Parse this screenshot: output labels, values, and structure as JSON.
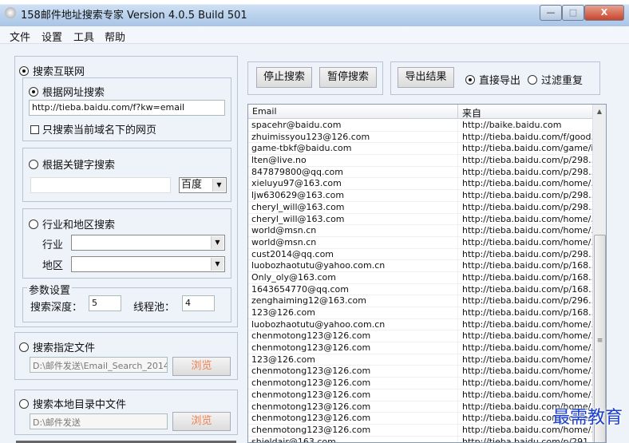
{
  "window": {
    "title": "158邮件地址搜索专家 Version 4.0.5 Build 501",
    "minimize": "—",
    "maximize": "□",
    "close": "X"
  },
  "menu": [
    "文件",
    "设置",
    "工具",
    "帮助"
  ],
  "left": {
    "internet": {
      "label": "搜索互联网",
      "selected": true
    },
    "url_search": {
      "label": "根据网址搜索",
      "selected": true,
      "url": "http://tieba.baidu.com/f?kw=email",
      "domain_only_label": "只搜索当前域名下的网页",
      "domain_only": false
    },
    "keyword_search": {
      "label": "根据关键字搜索",
      "selected": false,
      "keyword": "",
      "engine": "百度"
    },
    "industry_search": {
      "label": "行业和地区搜索",
      "selected": false,
      "industry_label": "行业",
      "industry": "",
      "region_label": "地区",
      "region": ""
    },
    "params": {
      "title": "参数设置",
      "depth_label": "搜索深度：",
      "depth": "5",
      "threads_label": "线程池：",
      "threads": "4"
    },
    "file_search": {
      "label": "搜索指定文件",
      "selected": false,
      "path": "D:\\邮件发送\\Email_Search_2014-",
      "browse": "浏览"
    },
    "dir_search": {
      "label": "搜索本地目录中文件",
      "selected": false,
      "path": "D:\\邮件发送",
      "browse": "浏览"
    }
  },
  "toolbar": {
    "stop": "停止搜索",
    "pause": "暂停搜索",
    "export": "导出结果",
    "direct_export": "直接导出",
    "direct_export_selected": true,
    "filter_dup": "过滤重复",
    "filter_dup_selected": false
  },
  "table": {
    "columns": [
      "Email",
      "来自"
    ],
    "rows": [
      [
        "spacehr@baidu.com",
        "http://baike.baidu.com"
      ],
      [
        "zhuimissyou123@126.com",
        "http://tieba.baidu.com/f/good..."
      ],
      [
        "game-tbkf@baidu.com",
        "http://tieba.baidu.com/game/i..."
      ],
      [
        "lten@live.no",
        "http://tieba.baidu.com/p/298..."
      ],
      [
        "847879800@qq.com",
        "http://tieba.baidu.com/p/298..."
      ],
      [
        "xieluyu97@163.com",
        "http://tieba.baidu.com/home/..."
      ],
      [
        "ljw630629@163.com",
        "http://tieba.baidu.com/p/298..."
      ],
      [
        "cheryl_will@163.com",
        "http://tieba.baidu.com/p/298..."
      ],
      [
        "cheryl_will@163.com",
        "http://tieba.baidu.com/home/..."
      ],
      [
        "world@msn.cn",
        "http://tieba.baidu.com/home/..."
      ],
      [
        "world@msn.cn",
        "http://tieba.baidu.com/home/..."
      ],
      [
        "cust2014@qq.com",
        "http://tieba.baidu.com/p/298..."
      ],
      [
        "luobozhaotutu@yahoo.com.cn",
        "http://tieba.baidu.com/p/168..."
      ],
      [
        "Only_oly@163.com",
        "http://tieba.baidu.com/p/168..."
      ],
      [
        "1643654770@qq.com",
        "http://tieba.baidu.com/p/168..."
      ],
      [
        "zenghaiming12@163.com",
        "http://tieba.baidu.com/p/296..."
      ],
      [
        "123@126.com",
        "http://tieba.baidu.com/p/168..."
      ],
      [
        "luobozhaotutu@yahoo.com.cn",
        "http://tieba.baidu.com/home/..."
      ],
      [
        "chenmotong123@126.com",
        "http://tieba.baidu.com/home/..."
      ],
      [
        "chenmotong123@126.com",
        "http://tieba.baidu.com/home/..."
      ],
      [
        "123@126.com",
        "http://tieba.baidu.com/home/..."
      ],
      [
        "chenmotong123@126.com",
        "http://tieba.baidu.com/home/..."
      ],
      [
        "chenmotong123@126.com",
        "http://tieba.baidu.com/home/..."
      ],
      [
        "chenmotong123@126.com",
        "http://tieba.baidu.com/home/..."
      ],
      [
        "chenmotong123@126.com",
        "http://tieba.baidu.com/home/..."
      ],
      [
        "chenmotong123@126.com",
        "http://tieba.baidu.com/home/..."
      ],
      [
        "chenmotong123@126.com",
        "http://tieba.baidu.com/home/..."
      ],
      [
        "shieldair@163.com",
        "http://tieba.baidu.com/p/291..."
      ]
    ]
  },
  "watermark": "最需教育"
}
